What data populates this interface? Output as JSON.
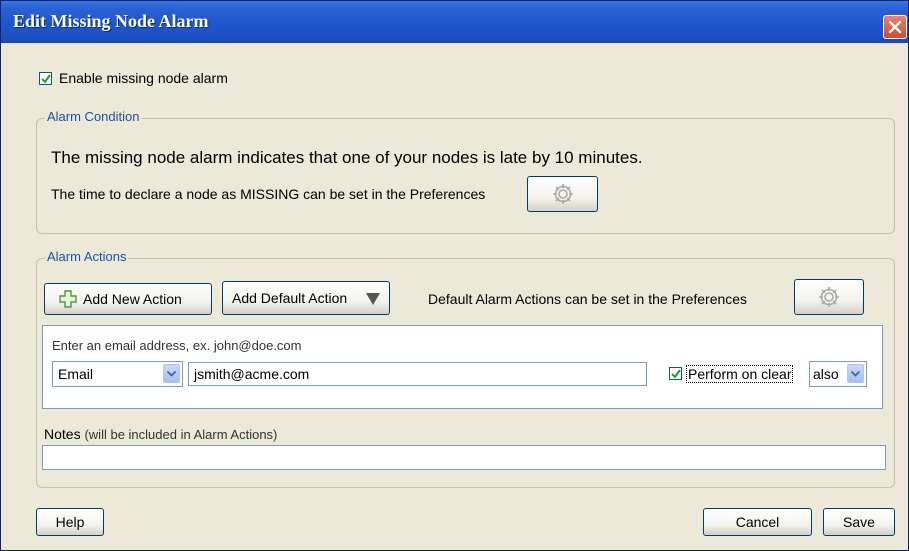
{
  "window": {
    "title": "Edit Missing Node Alarm"
  },
  "enable": {
    "label": "Enable missing node alarm",
    "checked": true
  },
  "condition": {
    "legend": "Alarm Condition",
    "description": "The missing node alarm indicates that one of your nodes is late by 10 minutes.",
    "preference_note": "The time to declare a node as MISSING can be set in the Preferences"
  },
  "actions": {
    "legend": "Alarm Actions",
    "add_new_label": "Add New Action",
    "add_default_label": "Add Default Action",
    "default_note": "Default Alarm Actions can be set in the Preferences",
    "email_hint": "Enter an email address, ex. john@doe.com",
    "type_value": "Email",
    "email_value": "jsmith@acme.com",
    "perform_on_clear_label": "Perform on clear",
    "perform_on_clear_checked": true,
    "also_value": "also"
  },
  "notes": {
    "label": "Notes",
    "hint": "(will be included in Alarm Actions)",
    "value": ""
  },
  "footer": {
    "help_label": "Help",
    "cancel_label": "Cancel",
    "save_label": "Save"
  },
  "icons": {
    "check": "check-icon",
    "gear": "gear-icon",
    "plus": "plus-icon",
    "close": "close-icon",
    "dropdown": "chevron-down-icon"
  },
  "colors": {
    "titlebar": "#1f57cc",
    "legend_text": "#1e4fa5",
    "background": "#ece9d8"
  }
}
